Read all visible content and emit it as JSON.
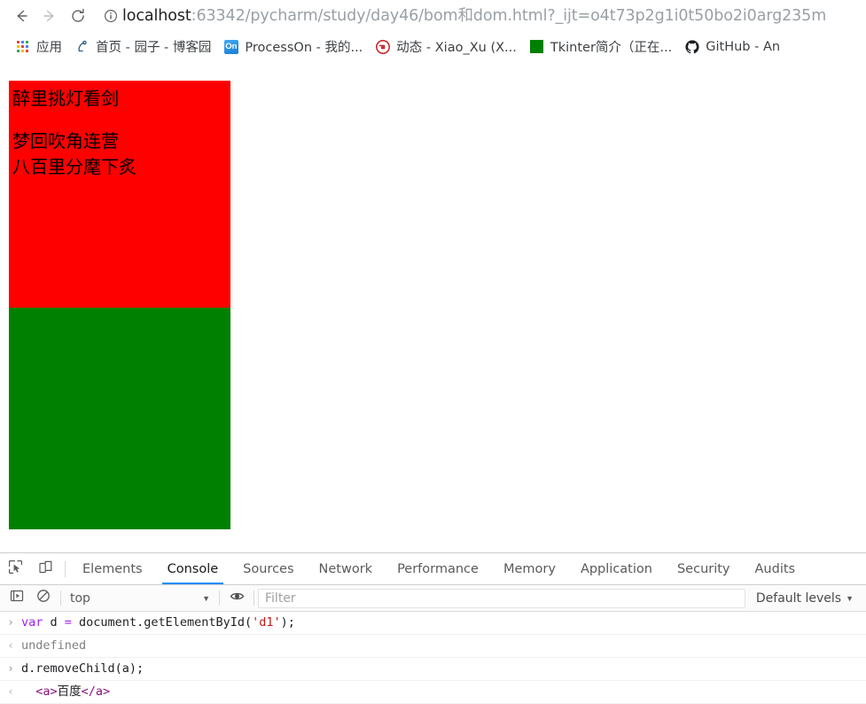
{
  "browser": {
    "nav": {
      "back_label": "Back",
      "forward_label": "Forward",
      "reload_label": "Reload",
      "back_icon": "arrow-left-icon",
      "forward_icon": "arrow-right-icon",
      "reload_icon": "reload-icon"
    },
    "omnibox": {
      "security_icon": "info-circle-icon",
      "host": "localhost",
      "path": ":63342/pycharm/study/day46/bom和dom.html?_ijt=o4t73p2g1i0t50bo2i0arg235m",
      "full_url": "localhost:63342/pycharm/study/day46/bom和dom.html?_ijt=o4t73p2g1i0t50bo2i0arg235m"
    },
    "bookmarks": [
      {
        "label": "应用",
        "icon": "apps-grid-icon"
      },
      {
        "label": "首页 - 园子 - 博客园",
        "icon": "cnblogs-icon"
      },
      {
        "label": "ProcessOn - 我的...",
        "icon": "processon-icon"
      },
      {
        "label": "动态 - Xiao_Xu (X...",
        "icon": "gitee-icon"
      },
      {
        "label": "Tkinter简介（正在...",
        "icon": "green-square-icon"
      },
      {
        "label": "GitHub - An",
        "icon": "github-icon"
      }
    ]
  },
  "page": {
    "red_box": {
      "color": "#ff0000",
      "lines": [
        "醉里挑灯看剑",
        "梦回吹角连营",
        "八百里分麾下炙"
      ]
    },
    "green_box": {
      "color": "#008000"
    }
  },
  "devtools": {
    "toolbar_icons": {
      "inspect": "inspect-element-icon",
      "device": "device-toolbar-icon"
    },
    "tabs": [
      {
        "label": "Elements",
        "active": false
      },
      {
        "label": "Console",
        "active": true
      },
      {
        "label": "Sources",
        "active": false
      },
      {
        "label": "Network",
        "active": false
      },
      {
        "label": "Performance",
        "active": false
      },
      {
        "label": "Memory",
        "active": false
      },
      {
        "label": "Application",
        "active": false
      },
      {
        "label": "Security",
        "active": false
      },
      {
        "label": "Audits",
        "active": false
      }
    ],
    "console_toolbar": {
      "sidebar_icon": "console-sidebar-icon",
      "clear_icon": "clear-console-icon",
      "context": "top",
      "context_caret": "▼",
      "eye_icon": "live-expression-eye-icon",
      "filter_placeholder": "Filter",
      "filter_value": "",
      "levels_label": "Default levels",
      "levels_caret": "▼"
    },
    "console_lines": [
      {
        "type": "input",
        "marker": "›",
        "tokens": [
          {
            "text": "var ",
            "kind": "keyword"
          },
          {
            "text": "d ",
            "kind": "plain"
          },
          {
            "text": "= ",
            "kind": "keyword"
          },
          {
            "text": "document.getElementById(",
            "kind": "plain"
          },
          {
            "text": "'d1'",
            "kind": "string"
          },
          {
            "text": ");",
            "kind": "plain"
          }
        ],
        "plain": "var d = document.getElementById('d1');"
      },
      {
        "type": "output",
        "marker": "‹",
        "tokens": [
          {
            "text": "undefined",
            "kind": "undefined"
          }
        ],
        "plain": "undefined"
      },
      {
        "type": "input",
        "marker": "›",
        "tokens": [
          {
            "text": "d.removeChild(a);",
            "kind": "plain"
          }
        ],
        "plain": "d.removeChild(a);"
      },
      {
        "type": "output",
        "marker": "‹",
        "tokens": [
          {
            "text": "  <a>",
            "kind": "tag"
          },
          {
            "text": "百度",
            "kind": "text"
          },
          {
            "text": "</a>",
            "kind": "tag"
          }
        ],
        "plain": "  <a>百度</a>"
      }
    ]
  }
}
